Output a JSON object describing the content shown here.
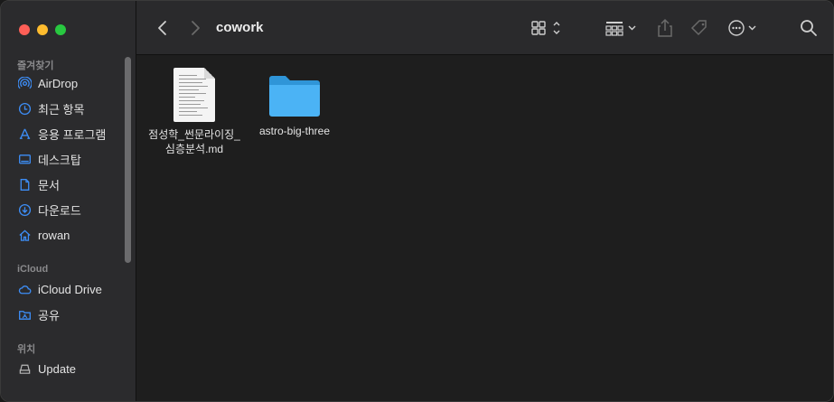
{
  "window": {
    "title": "cowork"
  },
  "sidebar": {
    "favorites_header": "즐겨찾기",
    "favorites": [
      {
        "label": "AirDrop",
        "icon": "airdrop-icon"
      },
      {
        "label": "최근 항목",
        "icon": "clock-icon"
      },
      {
        "label": "응용 프로그램",
        "icon": "applications-icon"
      },
      {
        "label": "데스크탑",
        "icon": "desktop-icon"
      },
      {
        "label": "문서",
        "icon": "document-icon"
      },
      {
        "label": "다운로드",
        "icon": "download-icon"
      },
      {
        "label": "rowan",
        "icon": "home-icon"
      }
    ],
    "icloud_header": "iCloud",
    "icloud": [
      {
        "label": "iCloud Drive",
        "icon": "cloud-icon"
      },
      {
        "label": "공유",
        "icon": "shared-folder-icon"
      }
    ],
    "locations_header": "위치",
    "locations": [
      {
        "label": "Update",
        "icon": "disk-icon"
      }
    ]
  },
  "files": [
    {
      "name_line1": "점성학_썬문라이징_",
      "name_line2": "심층분석.md",
      "kind": "document"
    },
    {
      "name_line1": "astro-big-three",
      "name_line2": "",
      "kind": "folder"
    }
  ],
  "colors": {
    "accent": "#3d8ef7",
    "folder": "#4bb3f5"
  }
}
